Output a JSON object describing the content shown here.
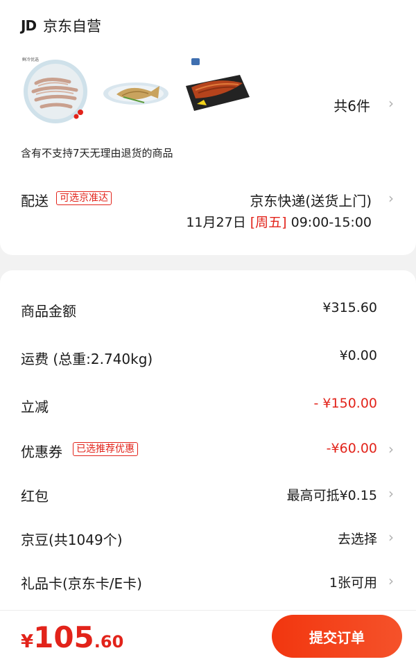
{
  "shop": {
    "logo": "JD",
    "name": "京东自营"
  },
  "products": {
    "items": [
      {
        "name": "shrimp",
        "brand_mark": "鲜冷优选"
      },
      {
        "name": "yellow-croaker"
      },
      {
        "name": "grilled-eel"
      }
    ],
    "count_label": "共6件"
  },
  "notice": "含有不支持7天无理由退货的商品",
  "delivery": {
    "label": "配送",
    "tag": "可选京准达",
    "method": "京东快递(送货上门)",
    "date": "11月27日",
    "weekday": "[周五]",
    "time_range": "09:00-15:00"
  },
  "summary": {
    "goods_amount": {
      "label": "商品金额",
      "value": "¥315.60"
    },
    "shipping": {
      "label": "运费 (总重:2.740kg)",
      "value": "¥0.00"
    },
    "discount": {
      "label": "立减",
      "value": "- ¥150.00"
    },
    "coupon": {
      "label": "优惠券",
      "tag": "已选推荐优惠",
      "value": "-¥60.00"
    },
    "red_packet": {
      "label": "红包",
      "value": "最高可抵¥0.15"
    },
    "jd_beans": {
      "label": "京豆(共1049个)",
      "value": "去选择"
    },
    "gift_card": {
      "label": "礼品卡(京东卡/E卡)",
      "value": "1张可用"
    }
  },
  "footer": {
    "currency": "¥",
    "total_int": "105",
    "total_dec": ".60",
    "submit_label": "提交订单"
  },
  "colors": {
    "accent": "#e2231a",
    "button_start": "#f2360f",
    "button_end": "#f5522a"
  }
}
